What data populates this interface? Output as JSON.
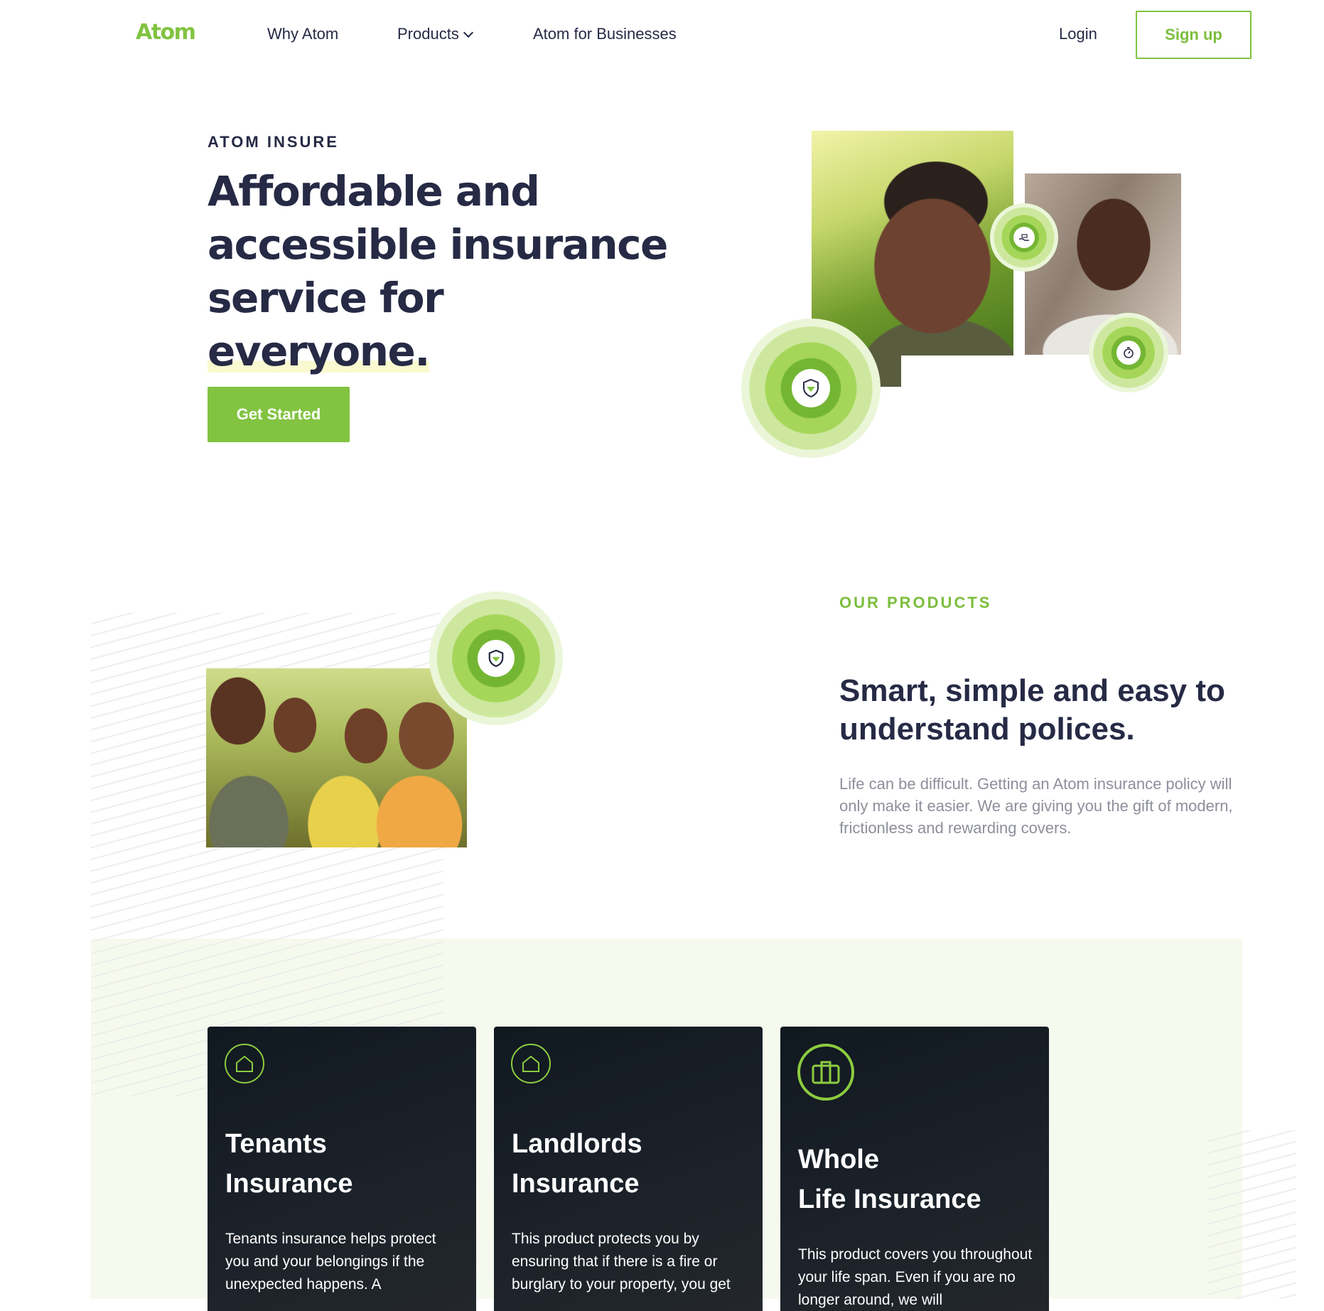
{
  "nav": {
    "logo": "Atom",
    "links": [
      "Why Atom",
      "Products",
      "Atom for Businesses"
    ],
    "login": "Login",
    "signup": "Sign up"
  },
  "hero": {
    "eyebrow": "ATOM INSURE",
    "title_line1": "Affordable and",
    "title_line2": "accessible insurance",
    "title_line3_a": "service for ",
    "title_line3_b": "everyone.",
    "cta": "Get Started"
  },
  "products": {
    "eyebrow": "OUR PRODUCTS",
    "title": "Smart, simple and easy to understand polices.",
    "copy": "Life can be difficult. Getting an Atom insurance policy will only make it easier. We are giving you the gift of modern, frictionless and rewarding covers."
  },
  "cards": [
    {
      "title_l1": "Tenants",
      "title_l2": "Insurance",
      "text": "Tenants insurance helps protect you and your belongings if the unexpected happens. A",
      "icon": "home-icon"
    },
    {
      "title_l1": "Landlords",
      "title_l2": "Insurance",
      "text": "This product protects you by ensuring that if there is a fire or burglary to your property, you get",
      "icon": "home-icon"
    },
    {
      "title_l1": "Whole",
      "title_l2": "Life Insurance",
      "text": "This product covers you throughout your life span. Even if you are no longer around, we will",
      "icon": "briefcase-icon"
    }
  ],
  "colors": {
    "brand_green": "#82c341",
    "navy": "#262a45",
    "card_dark": "#151b22"
  }
}
